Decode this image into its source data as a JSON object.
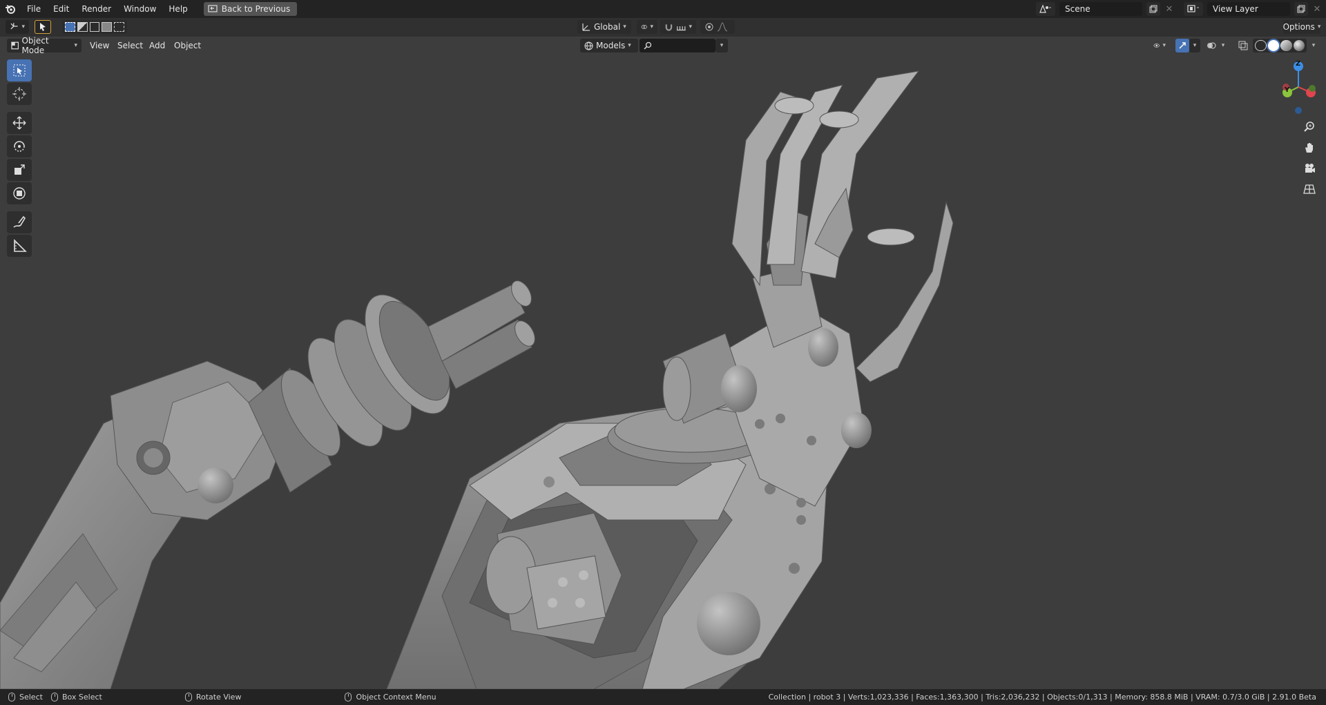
{
  "app": {
    "logo_icon": "blender-logo-icon"
  },
  "menubar": {
    "items": [
      "File",
      "Edit",
      "Render",
      "Window",
      "Help"
    ],
    "back_button": "Back to Previous"
  },
  "topbar_right": {
    "scene_label": "Scene",
    "view_layer_label": "View Layer"
  },
  "tool_header": {
    "transform_orientation": "Global",
    "options_label": "Options"
  },
  "view_header": {
    "mode": "Object Mode",
    "menus": [
      "View",
      "Select",
      "Add",
      "Object"
    ],
    "search_scope": "Models",
    "search_value": ""
  },
  "toolbar": {
    "tools": [
      "select-box-icon",
      "cursor-icon",
      "move-icon",
      "rotate-icon",
      "scale-icon",
      "transform-icon",
      "annotate-icon",
      "measure-icon"
    ],
    "active": "select-box-icon"
  },
  "gizmo": {
    "axes": {
      "z": "Z",
      "y": "Y"
    },
    "colors": {
      "x": "#e0454f",
      "y": "#8cc43e",
      "z": "#3c8ee6"
    }
  },
  "statusbar": {
    "select": "Select",
    "box_select": "Box Select",
    "rotate_view": "Rotate View",
    "context_menu": "Object Context Menu",
    "stats": "Collection | robot 3 | Verts:1,023,336 | Faces:1,363,300 | Tris:2,036,232 | Objects:0/1,313 | Memory: 858.8 MiB | VRAM: 0.7/3.0 GiB | 2.91.0 Beta"
  },
  "colors": {
    "accent": "#4772b3",
    "viewport_bg": "#3d3d3d",
    "model_gray": "#8a8a8a"
  }
}
